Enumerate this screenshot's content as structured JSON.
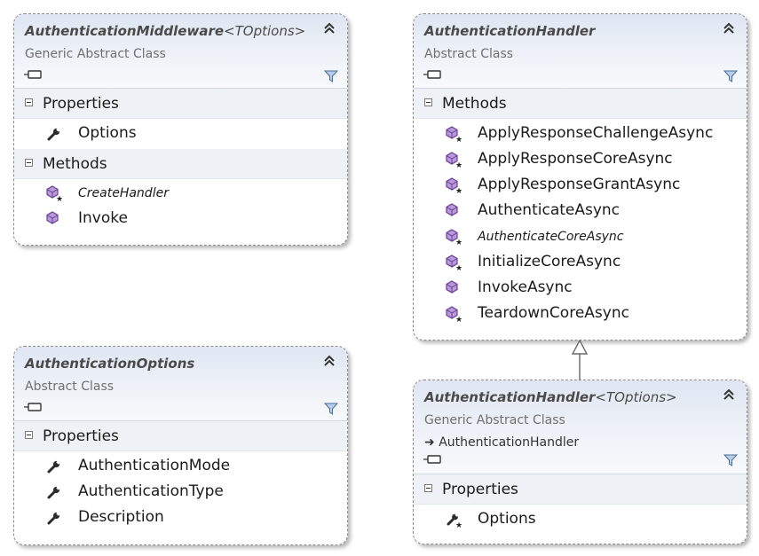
{
  "shapes": {
    "middleware": {
      "name": "AuthenticationMiddleware",
      "type_params": "<TOptions>",
      "kind": "Generic Abstract Class",
      "sections": [
        {
          "label": "Properties",
          "members": [
            {
              "name": "Options",
              "icon": "wrench-property-icon",
              "italic": false
            }
          ]
        },
        {
          "label": "Methods",
          "members": [
            {
              "name": "CreateHandler",
              "icon": "protected-method-icon",
              "italic": true
            },
            {
              "name": "Invoke",
              "icon": "method-icon",
              "italic": false
            }
          ]
        }
      ]
    },
    "handler": {
      "name": "AuthenticationHandler",
      "kind": "Abstract Class",
      "sections": [
        {
          "label": "Methods",
          "members": [
            {
              "name": "ApplyResponseChallengeAsync",
              "icon": "protected-method-icon",
              "italic": false
            },
            {
              "name": "ApplyResponseCoreAsync",
              "icon": "protected-method-icon",
              "italic": false
            },
            {
              "name": "ApplyResponseGrantAsync",
              "icon": "protected-method-icon",
              "italic": false
            },
            {
              "name": "AuthenticateAsync",
              "icon": "method-icon",
              "italic": false
            },
            {
              "name": "AuthenticateCoreAsync",
              "icon": "protected-method-icon",
              "italic": true
            },
            {
              "name": "InitializeCoreAsync",
              "icon": "protected-method-icon",
              "italic": false
            },
            {
              "name": "InvokeAsync",
              "icon": "method-icon",
              "italic": false
            },
            {
              "name": "TeardownCoreAsync",
              "icon": "protected-method-icon",
              "italic": false
            }
          ]
        }
      ]
    },
    "options": {
      "name": "AuthenticationOptions",
      "kind": "Abstract Class",
      "sections": [
        {
          "label": "Properties",
          "members": [
            {
              "name": "AuthenticationMode",
              "icon": "wrench-property-icon",
              "italic": false
            },
            {
              "name": "AuthenticationType",
              "icon": "wrench-property-icon",
              "italic": false
            },
            {
              "name": "Description",
              "icon": "wrench-property-icon",
              "italic": false
            }
          ]
        }
      ]
    },
    "handler_generic": {
      "name": "AuthenticationHandler",
      "type_params": "<TOptions>",
      "kind": "Generic Abstract Class",
      "inherits": "AuthenticationHandler",
      "sections": [
        {
          "label": "Properties",
          "members": [
            {
              "name": "Options",
              "icon": "protected-property-icon",
              "italic": false
            }
          ]
        }
      ]
    }
  },
  "colors": {
    "method_icon": "#7b4fa8",
    "header_top": "#dfe6f2",
    "section_bg": "#eef1f6",
    "border": "#8a8a8a"
  }
}
